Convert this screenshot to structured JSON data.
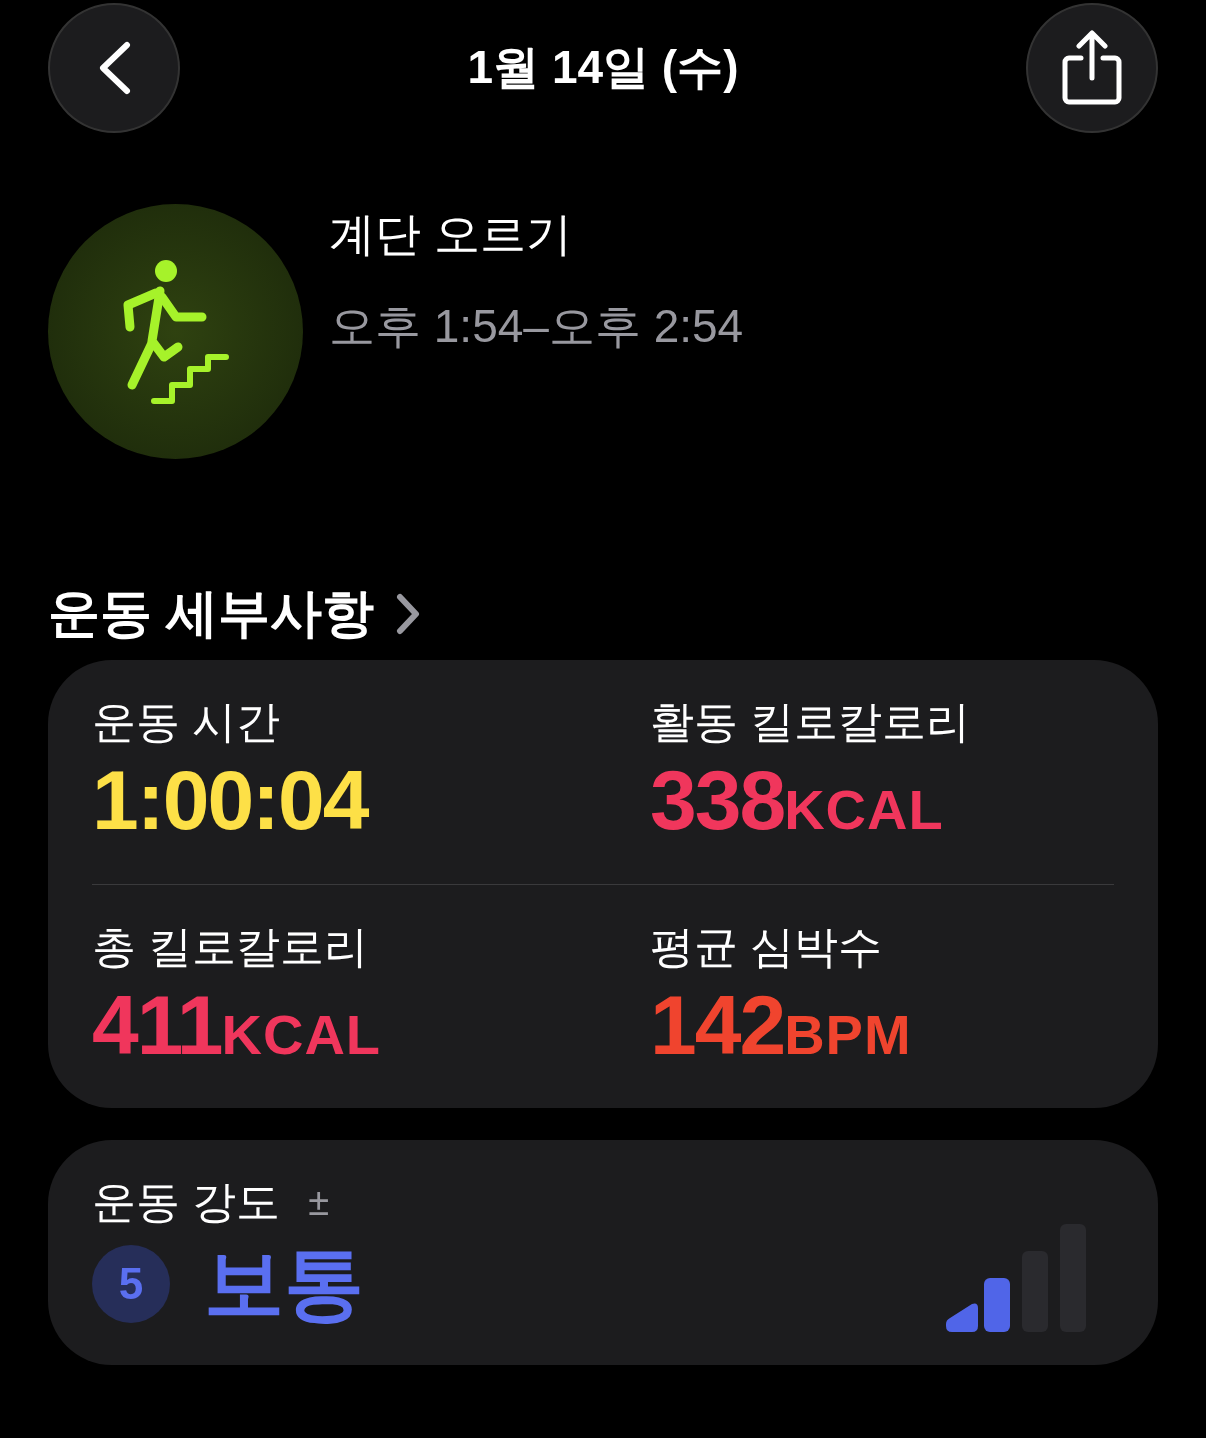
{
  "header": {
    "title": "1월 14일 (수)"
  },
  "workout": {
    "name": "계단 오르기",
    "time": "오후 1:54–오후 2:54"
  },
  "section": {
    "title": "운동 세부사항"
  },
  "metrics": [
    {
      "label": "운동 시간",
      "value": "1:00:04",
      "color": "#fde047"
    },
    {
      "label": "활동 킬로칼로리",
      "value": "338",
      "unit": "KCAL",
      "color": "#f0365c"
    },
    {
      "label": "총 킬로칼로리",
      "value": "411",
      "unit": "KCAL",
      "color": "#f0365c"
    },
    {
      "label": "평균 심박수",
      "value": "142",
      "unit": "BPM",
      "color": "#f0442e"
    }
  ],
  "intensity": {
    "label": "운동 강도",
    "symbol": "±",
    "score": "5",
    "level_text": "보통"
  }
}
